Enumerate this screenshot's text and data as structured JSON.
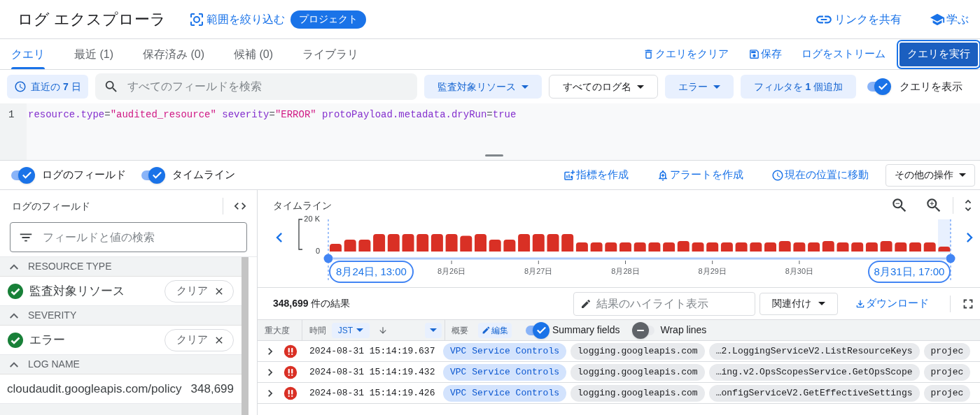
{
  "header": {
    "title": "ログ エクスプローラ",
    "scope_button": "範囲を絞り込む",
    "scope_chip": "プロジェクト",
    "share_link": "リンクを共有",
    "learn": "学ぶ"
  },
  "tabs": [
    {
      "label": "クエリ",
      "selected": true
    },
    {
      "label": "最近 (1)",
      "selected": false
    },
    {
      "label": "保存済み (0)",
      "selected": false
    },
    {
      "label": "候補 (0)",
      "selected": false
    },
    {
      "label": "ライブラリ",
      "selected": false
    }
  ],
  "query_actions": [
    {
      "kind": "clear",
      "label": "クエリをクリア"
    },
    {
      "kind": "save",
      "label": "保存"
    },
    {
      "kind": "stream",
      "label": "ログをストリーム"
    },
    {
      "kind": "run",
      "label": "クエリを実行"
    }
  ],
  "filters": {
    "time_range": "直近の **7** 日",
    "search_placeholder": "すべてのフィールドを検索",
    "chips": [
      {
        "kind": "active",
        "label": "監査対象リソース",
        "dropdown": true
      },
      {
        "kind": "outline",
        "label": "すべてのログ名",
        "dropdown": true
      },
      {
        "kind": "active",
        "label": "エラー",
        "dropdown": true
      },
      {
        "kind": "active",
        "label": "フィルタを **1** 個追加",
        "dropdown": false
      }
    ],
    "show_query": {
      "label": "クエリを表示",
      "on": true
    }
  },
  "editor": {
    "line_number": "1",
    "tokens": [
      {
        "kind": "key",
        "text": "resource.type"
      },
      {
        "kind": "op",
        "text": "="
      },
      {
        "kind": "string",
        "text": "\"audited_resource\""
      },
      {
        "kind": "key",
        "text": " severity"
      },
      {
        "kind": "op",
        "text": "="
      },
      {
        "kind": "string",
        "text": "\"ERROR\""
      },
      {
        "kind": "key",
        "text": " protoPayload.metadata.dryRun"
      },
      {
        "kind": "op",
        "text": "="
      },
      {
        "kind": "key",
        "text": "true"
      }
    ]
  },
  "view_toggles": [
    {
      "label": "ログのフィールド",
      "on": true
    },
    {
      "label": "タイムライン",
      "on": true
    }
  ],
  "view_actions": [
    {
      "kind": "metric",
      "label": "指標を作成"
    },
    {
      "kind": "alert",
      "label": "アラートを作成"
    },
    {
      "kind": "now",
      "label": "現在の位置に移動"
    },
    {
      "kind": "more",
      "label": "その他の操作"
    }
  ],
  "fields_panel": {
    "title": "ログのフィールド",
    "search_placeholder": "フィールドと値の検索",
    "sections": [
      {
        "heading": "RESOURCE TYPE",
        "expanded": true,
        "items": [
          {
            "label": "監査対象リソース",
            "selected": true,
            "clear": "クリア"
          }
        ]
      },
      {
        "heading": "SEVERITY",
        "expanded": true,
        "items": [
          {
            "label": "エラー",
            "selected": true,
            "clear": "クリア"
          }
        ]
      },
      {
        "heading": "LOG NAME",
        "expanded": true,
        "items": [
          {
            "label": "cloudaudit.googleapis.com/policy",
            "selected": false,
            "count": "348,699"
          }
        ]
      }
    ]
  },
  "timeline": {
    "title": "タイムライン",
    "range_start": "8月24日, 13:00",
    "range_end": "8月31日, 17:00",
    "y_labels": [
      "20 K",
      "0"
    ],
    "date_labels": [
      "8月26日",
      "8月27日",
      "8月28日",
      "8月29日",
      "8月30日"
    ]
  },
  "results": {
    "count": "**348,699** 件の結果",
    "highlight_placeholder": "結果のハイライト表示",
    "correlate": "関連付け",
    "download": "ダウンロード"
  },
  "table": {
    "severity_header": "重大度",
    "time_header": "時間",
    "timezone": "JST",
    "summary_header": "概要",
    "edit": "編集",
    "toggles": [
      {
        "label": "Summary fields",
        "on": true
      },
      {
        "label": "Wrap lines",
        "on": false
      }
    ],
    "rows": [
      {
        "kind": "error",
        "time": "2024-08-31 15:14:19.637",
        "chips": [
          {
            "kind": "service",
            "text": "VPC Service Controls"
          },
          {
            "kind": "plain",
            "text": "logging.googleapis.com"
          },
          {
            "kind": "plain",
            "text": "…2.LoggingServiceV2.ListResourceKeys"
          },
          {
            "kind": "plain",
            "text": "projec"
          }
        ]
      },
      {
        "kind": "error",
        "time": "2024-08-31 15:14:19.432",
        "chips": [
          {
            "kind": "service",
            "text": "VPC Service Controls"
          },
          {
            "kind": "plain",
            "text": "logging.googleapis.com"
          },
          {
            "kind": "plain",
            "text": "…ing.v2.OpsScopesService.GetOpsScope"
          },
          {
            "kind": "plain",
            "text": "projec"
          }
        ]
      },
      {
        "kind": "error",
        "time": "2024-08-31 15:14:19.426",
        "chips": [
          {
            "kind": "service",
            "text": "VPC Service Controls"
          },
          {
            "kind": "plain",
            "text": "logging.googleapis.com"
          },
          {
            "kind": "plain",
            "text": "…onfigServiceV2.GetEffectiveSettings"
          },
          {
            "kind": "plain",
            "text": "projec"
          }
        ]
      }
    ]
  }
}
